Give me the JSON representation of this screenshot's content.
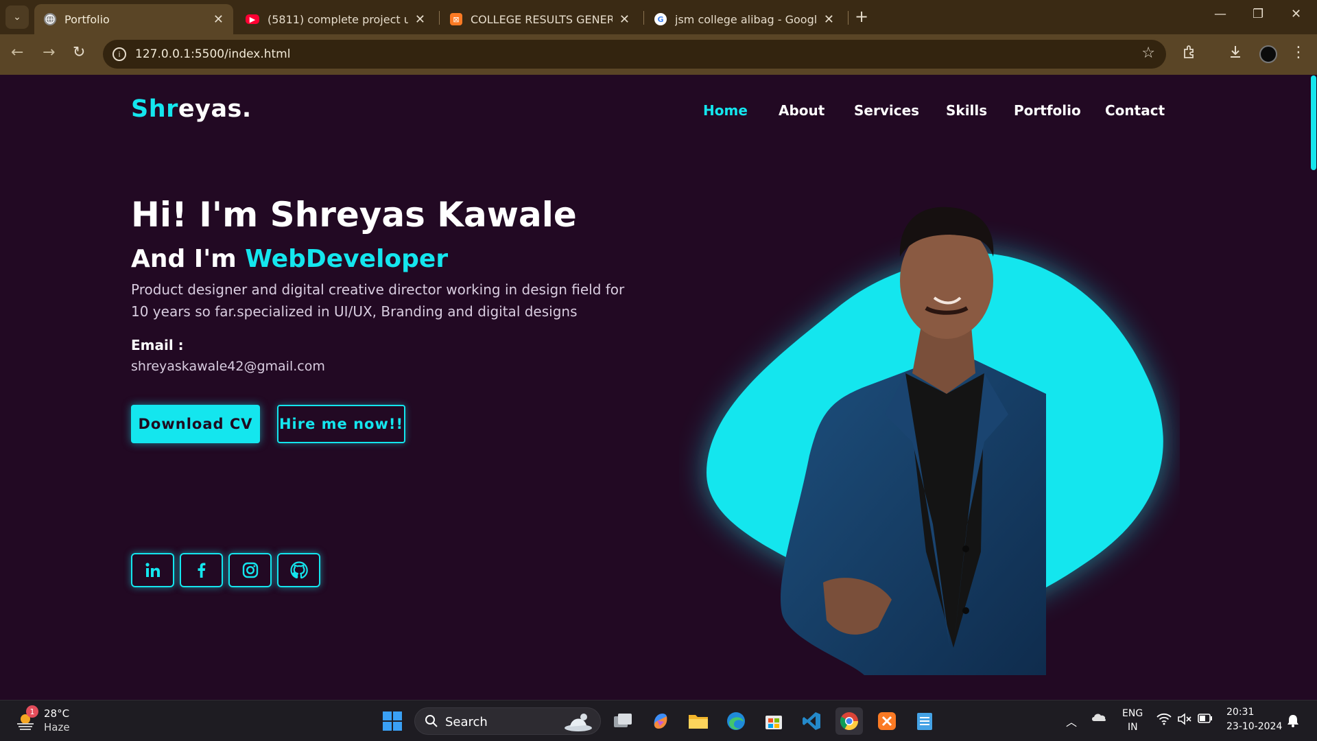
{
  "browser": {
    "tabs": [
      {
        "title": "Portfolio",
        "active": true,
        "favicon": "globe-icon"
      },
      {
        "title": "(5811) complete project using h",
        "active": false,
        "favicon": "youtube-icon"
      },
      {
        "title": "COLLEGE RESULTS GENERATOR",
        "active": false,
        "favicon": "xampp-icon"
      },
      {
        "title": "jsm college alibag - Google Sea",
        "active": false,
        "favicon": "google-icon"
      }
    ],
    "url": "127.0.0.1:5500/index.html"
  },
  "site": {
    "logo_accent": "Shr",
    "logo_rest": "eyas.",
    "nav": [
      {
        "label": "Home",
        "active": true
      },
      {
        "label": "About",
        "active": false
      },
      {
        "label": "Services",
        "active": false
      },
      {
        "label": "Skills",
        "active": false
      },
      {
        "label": "Portfolio",
        "active": false
      },
      {
        "label": "Contact",
        "active": false
      }
    ],
    "heading": "Hi! I'm Shreyas Kawale",
    "subheading_prefix": "And I'm",
    "subheading_role": "WebDeveloper",
    "bio": "Product designer and digital creative director working in design field for 10 years so far.specialized in UI/UX, Branding and digital designs",
    "email_label": "Email :",
    "email": "shreyaskawale42@gmail.com",
    "btn_download": "Download CV",
    "btn_hire": "Hire me now!!",
    "socials": [
      "linkedin-icon",
      "facebook-icon",
      "instagram-icon",
      "github-icon"
    ],
    "accent_color": "#14e6ee",
    "background_color": "#220923"
  },
  "taskbar": {
    "weather_badge": "1",
    "weather_temp": "28°C",
    "weather_cond": "Haze",
    "search_label": "Search",
    "lang_top": "ENG",
    "lang_bottom": "IN",
    "time": "20:31",
    "date": "23-10-2024"
  }
}
